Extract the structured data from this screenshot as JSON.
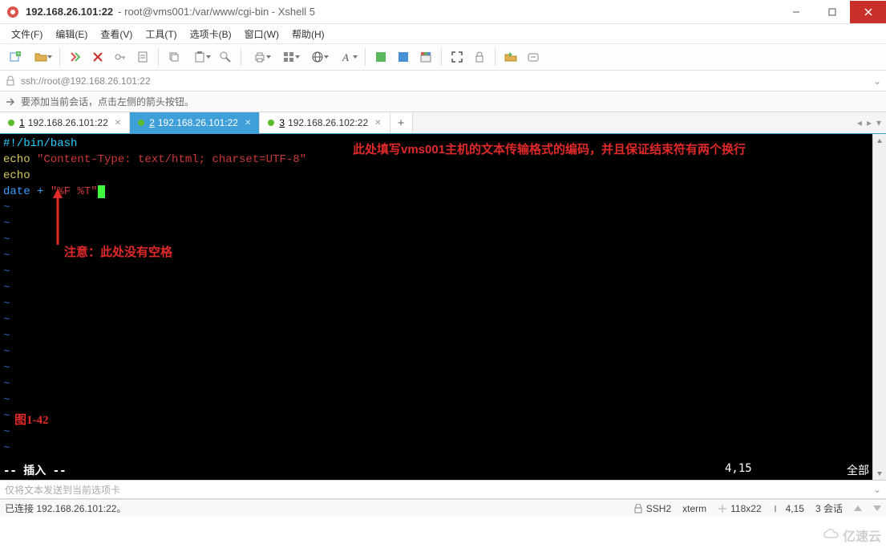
{
  "titlebar": {
    "main": "192.168.26.101:22",
    "sub": "root@vms001:/var/www/cgi-bin - Xshell 5"
  },
  "menus": {
    "file": "文件(F)",
    "edit": "编辑(E)",
    "view": "查看(V)",
    "tools": "工具(T)",
    "tabs": "选项卡(B)",
    "window": "窗口(W)",
    "help": "帮助(H)"
  },
  "address": {
    "url": "ssh://root@192.168.26.101:22"
  },
  "hint": {
    "text": "要添加当前会话，点击左侧的箭头按钮。"
  },
  "tabs": [
    {
      "num": "1",
      "label": "192.168.26.101:22",
      "active": false
    },
    {
      "num": "2",
      "label": "192.168.26.101:22",
      "active": true
    },
    {
      "num": "3",
      "label": "192.168.26.102:22",
      "active": false
    }
  ],
  "terminal": {
    "line1_shebang": "#!/bin/bash",
    "line2a": "echo",
    "line2b": " \"Content-Type: text/html; charset=UTF-8\"",
    "line3": "echo",
    "line4a": "date +",
    "line4b": " \"%F %T\"",
    "annot_top": "此处填写vms001主机的文本传输格式的编码，并且保证结束符有两个换行",
    "annot_side": "注意：此处没有空格",
    "fig_label": "图1-42",
    "mode": "-- 插入 --",
    "cursor_pos": "4,15",
    "scroll_pct": "全部"
  },
  "bottominput": {
    "placeholder": "仅将文本发送到当前选项卡"
  },
  "statusbar": {
    "left": "已连接 192.168.26.101:22。",
    "proto": "SSH2",
    "term_type": "xterm",
    "size": "118x22",
    "pos": "4,15",
    "sessions": "3 会话"
  },
  "watermark": "亿速云"
}
